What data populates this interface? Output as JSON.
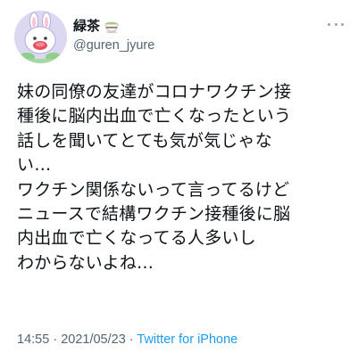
{
  "author": {
    "display_name": "緑茶",
    "handle": "@guren_jyure"
  },
  "tweet": {
    "lines": [
      "妹の同僚の友達がコロナワクチン接",
      "種後に脳内出血で亡くなったという",
      "話しを聞いてとても気が気じゃな",
      "い…",
      "ワクチン関係ないって言ってるけど",
      "ニュースで結構ワクチン接種後に脳",
      "内出血で亡くなってる人多いし",
      "わからないよね…"
    ]
  },
  "meta": {
    "time": "14:55",
    "separator1": " · ",
    "date": "2021/05/23",
    "separator2": " · ",
    "source": "Twitter for iPhone"
  },
  "icons": {
    "avatar": "avatar-illustration",
    "emoji": "matcha-cup-emoji",
    "more": "more-options-icon"
  },
  "colors": {
    "text": "#0f1419",
    "secondary": "#536471",
    "link": "#1d9bf0"
  }
}
